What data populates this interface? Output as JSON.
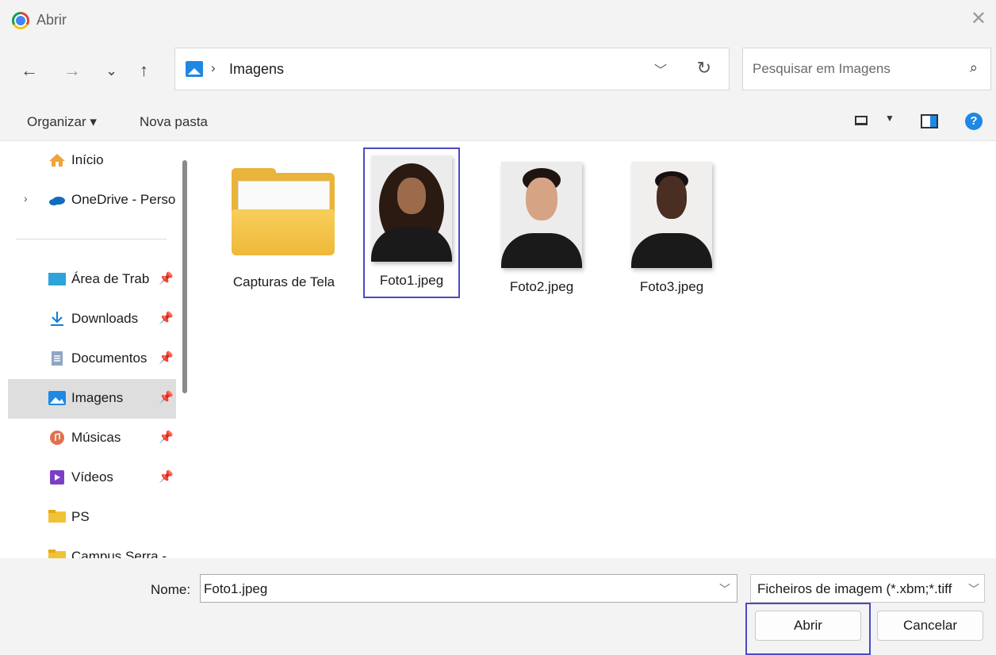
{
  "window": {
    "title": "Abrir",
    "close": "✕"
  },
  "nav": {
    "back": "←",
    "forward": "→",
    "recent": "⌄",
    "up": "↑",
    "path_separator": "›",
    "path": "Imagens",
    "search_placeholder": "Pesquisar em Imagens"
  },
  "toolbar": {
    "organize": "Organizar ▾",
    "new_folder": "Nova pasta",
    "help": "?"
  },
  "sidebar": {
    "items": [
      {
        "label": "Início"
      },
      {
        "label": "OneDrive - Perso"
      },
      {
        "label": "Área de Trab"
      },
      {
        "label": "Downloads"
      },
      {
        "label": "Documentos"
      },
      {
        "label": "Imagens"
      },
      {
        "label": "Músicas"
      },
      {
        "label": "Vídeos"
      },
      {
        "label": "PS"
      },
      {
        "label": "Campus Serra -"
      }
    ],
    "selected": "Imagens"
  },
  "files": [
    {
      "name": "Capturas de Tela",
      "type": "folder"
    },
    {
      "name": "Foto1.jpeg",
      "type": "image",
      "selected": true
    },
    {
      "name": "Foto2.jpeg",
      "type": "image"
    },
    {
      "name": "Foto3.jpeg",
      "type": "image"
    }
  ],
  "footer": {
    "name_label": "Nome:",
    "name_value": "Foto1.jpeg",
    "filter_value": "Ficheiros de imagem (*.xbm;*.tiff",
    "open_button": "Abrir",
    "cancel_button": "Cancelar"
  },
  "colors": {
    "accent": "#1e88e5",
    "highlight_box": "#4a4ac6",
    "folder": "#eab43a"
  }
}
